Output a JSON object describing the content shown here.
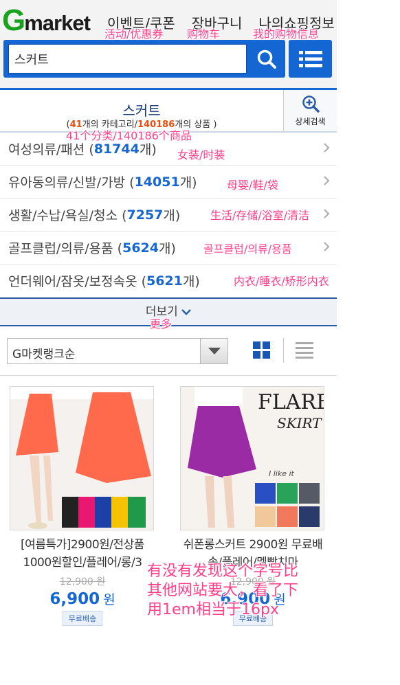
{
  "header": {
    "logo_g": "G",
    "logo_rest": "market",
    "nav": [
      {
        "label": "이벤트/쿠폰"
      },
      {
        "label": "장바구니"
      },
      {
        "label": "나의쇼핑정보"
      }
    ],
    "search_value": "스커트"
  },
  "result": {
    "keyword": "스커트",
    "open_paren": "(",
    "category_count": "41",
    "category_text": "개의 카테고리/",
    "product_count": "140186",
    "product_text": "개의 상품 )",
    "detail_label": "상세검색"
  },
  "categories": [
    {
      "name": "여성의류/패션 (",
      "count": "81744",
      "suffix": "개)"
    },
    {
      "name": "유아동의류/신발/가방 (",
      "count": "14051",
      "suffix": "개)"
    },
    {
      "name": "생활/수납/욕실/청소 (",
      "count": "7257",
      "suffix": "개)"
    },
    {
      "name": "골프클럽/의류/용품 (",
      "count": "5624",
      "suffix": "개)"
    },
    {
      "name": "언더웨어/잠옷/보정속옷 (",
      "count": "5621",
      "suffix": "개)"
    }
  ],
  "more_label": "더보기",
  "sort": {
    "selected": "G마켓랭크순"
  },
  "products": [
    {
      "name": "[여름특가]2900원/전상품1000원할인/플레어/롱/3",
      "original_price": "12,900 원",
      "price": "6,900",
      "unit": "원",
      "badge": "무료배송"
    },
    {
      "name": "쉬폰롱스커트 2900원 무료배송/플레어/멜빵치마",
      "original_price": "12,900 원",
      "price": "6,900",
      "unit": "원",
      "badge": "무료배송",
      "flare_word": "FLARE",
      "skirt_word": "SKIRT",
      "like_it": "I like it"
    }
  ],
  "annotations": {
    "nav_event": "活动/优惠券",
    "nav_cart": "购物车",
    "nav_myinfo": "我的购物信息",
    "counts": "41个分类/140186个商品",
    "cat1": "女装/时装",
    "cat2": "母婴/鞋/袋",
    "cat3": "生活/存储/浴室/清洁",
    "cat4": "골프클럽/의류/용품",
    "cat5": "内衣/睡衣/矫形内衣",
    "more": "更多",
    "font_note": "有没有发现这个字号比\n其他网站要大，看了下\n用1em相当于16px"
  },
  "colors": {
    "brand_blue": "#1466d2",
    "logo_green": "#19a21e",
    "count_orange": "#e84d0e",
    "annotation_pink": "#ff3f8a"
  }
}
